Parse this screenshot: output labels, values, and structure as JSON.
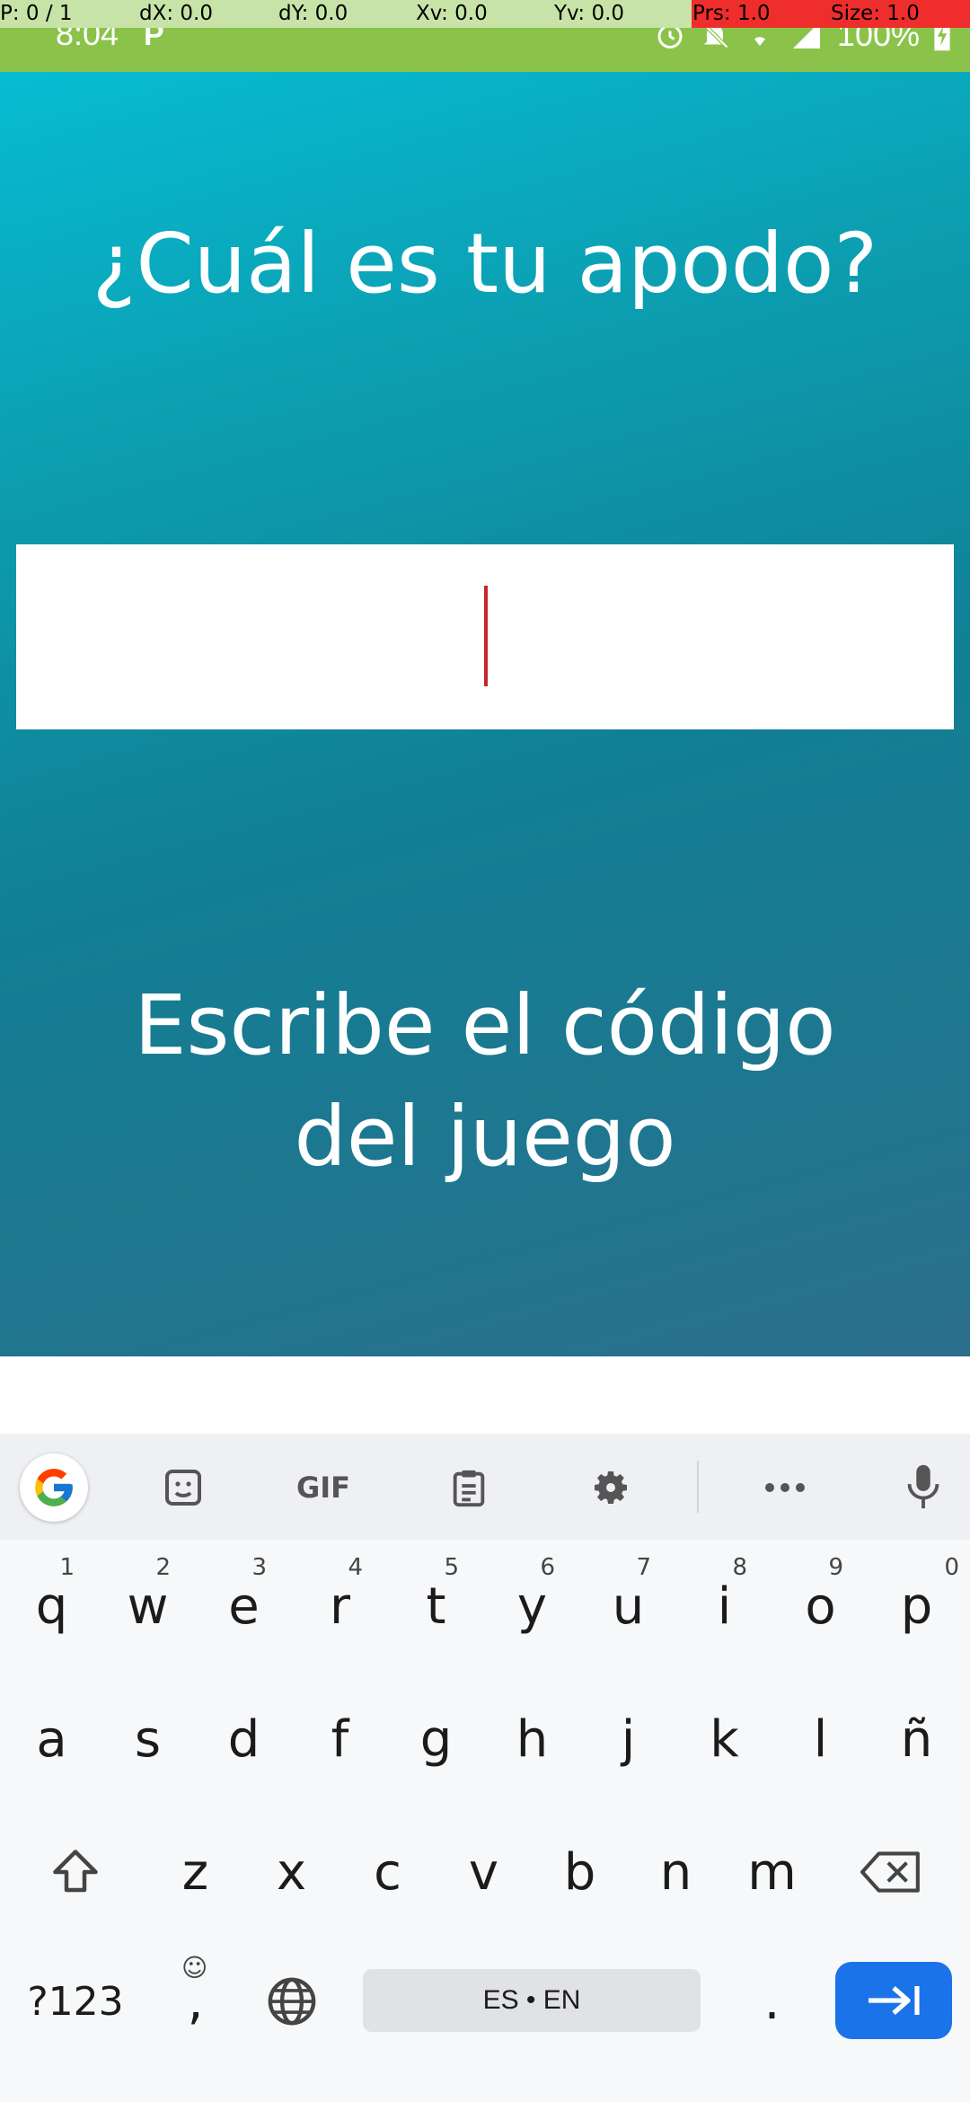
{
  "debug_overlay": {
    "pointer": "P: 0 / 1",
    "dx": "dX: 0.0",
    "dy": "dY: 0.0",
    "xv": "Xv: 0.0",
    "yv": "Yv: 0.0",
    "prs": "Prs: 1.0",
    "size": "Size: 1.0"
  },
  "status_bar": {
    "time": "8:04",
    "app_icon": "P",
    "battery": "100%",
    "icons": [
      "alarm-icon",
      "bell-off-icon",
      "wifi-icon",
      "signal-icon",
      "battery-charging-icon"
    ]
  },
  "screen": {
    "nickname_prompt": "¿Cuál es tu apodo?",
    "nickname_value": "",
    "game_code_prompt": "Escribe el código del juego",
    "colors": {
      "gradient_top": "#07bcd3",
      "gradient_bottom": "#2b6f8c",
      "caret": "#c62828"
    }
  },
  "keyboard": {
    "toolbar": [
      "google-icon",
      "sticker-icon",
      "GIF",
      "clipboard-icon",
      "gear-icon",
      "more-icon",
      "mic-icon"
    ],
    "gif_label": "GIF",
    "row1": [
      "q",
      "w",
      "e",
      "r",
      "t",
      "y",
      "u",
      "i",
      "o",
      "p"
    ],
    "row1_hints": [
      "1",
      "2",
      "3",
      "4",
      "5",
      "6",
      "7",
      "8",
      "9",
      "0"
    ],
    "row2": [
      "a",
      "s",
      "d",
      "f",
      "g",
      "h",
      "j",
      "k",
      "l",
      "ñ"
    ],
    "row3": [
      "z",
      "x",
      "c",
      "v",
      "b",
      "n",
      "m"
    ],
    "symbols_label": "?123",
    "comma_label": ",",
    "space_label": "ES • EN",
    "period_label": ".",
    "enter_color": "#1a73e8"
  }
}
